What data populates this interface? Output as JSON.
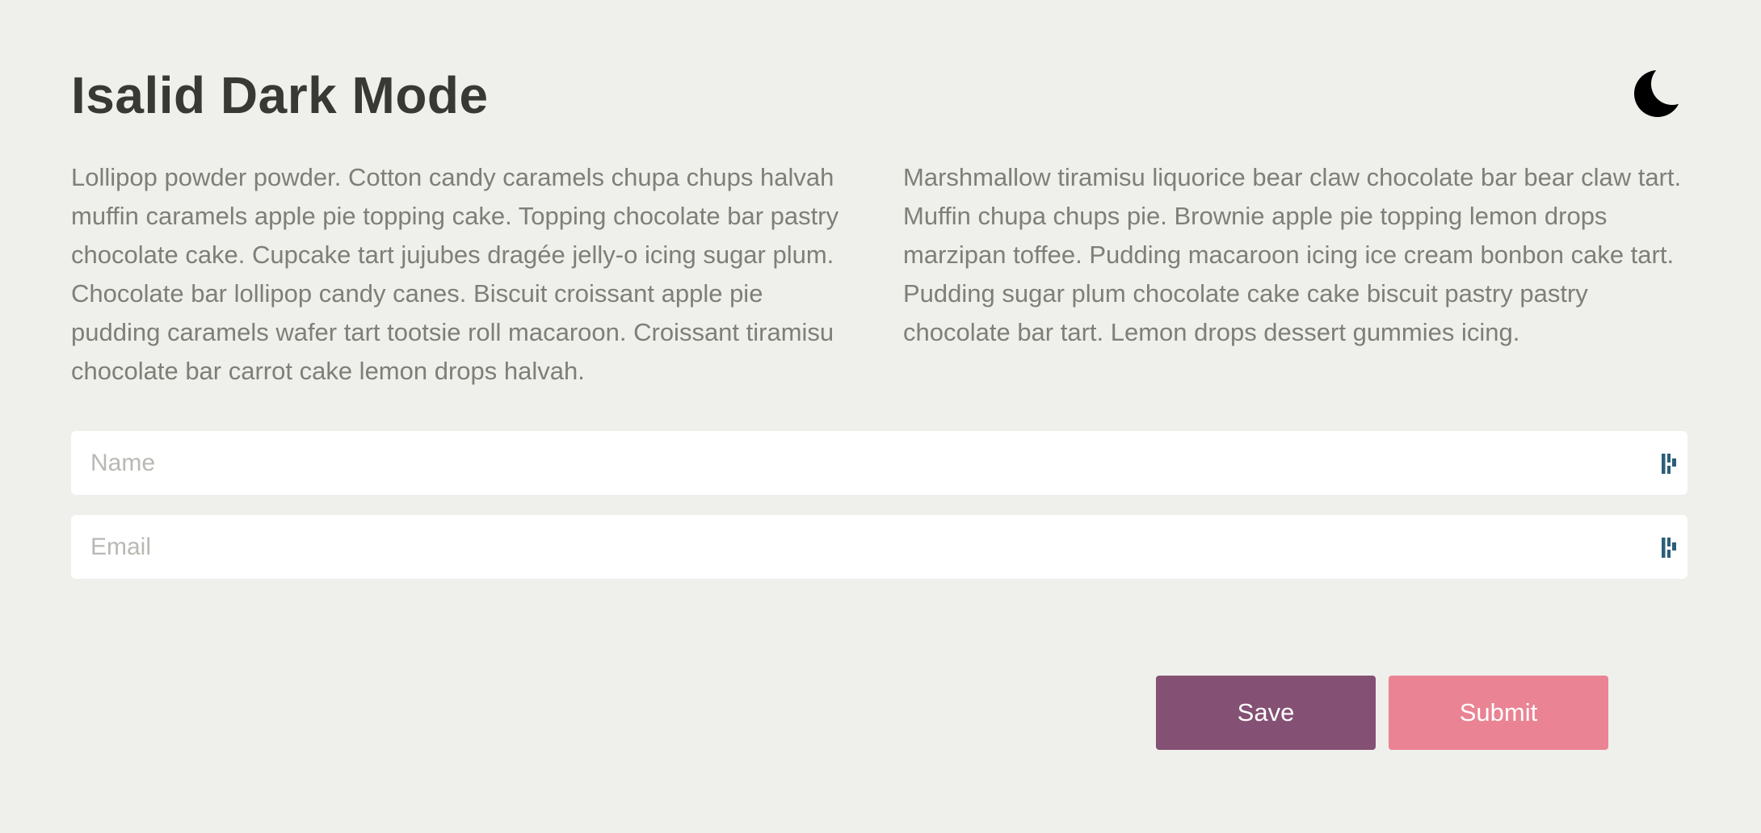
{
  "header": {
    "title": "Isalid Dark Mode",
    "toggle_icon": "moon-icon"
  },
  "content": {
    "paragraph_left": "Lollipop powder powder. Cotton candy caramels chupa chups halvah muffin caramels apple pie topping cake. Topping chocolate bar pastry chocolate cake. Cupcake tart jujubes dragée jelly-o icing sugar plum. Chocolate bar lollipop candy canes. Biscuit croissant apple pie pudding caramels wafer tart tootsie roll macaroon. Croissant tiramisu chocolate bar carrot cake lemon drops halvah.",
    "paragraph_right": "Marshmallow tiramisu liquorice bear claw chocolate bar bear claw tart. Muffin chupa chups pie. Brownie apple pie topping lemon drops marzipan toffee. Pudding macaroon icing ice cream bonbon cake tart. Pudding sugar plum chocolate cake cake biscuit pastry pastry chocolate bar tart. Lemon drops dessert gummies icing."
  },
  "form": {
    "name": {
      "placeholder": "Name",
      "value": "",
      "icon": "autofill-key-icon"
    },
    "email": {
      "placeholder": "Email",
      "value": "",
      "icon": "autofill-key-icon"
    }
  },
  "buttons": {
    "save_label": "Save",
    "submit_label": "Submit"
  },
  "colors": {
    "background": "#efefeb",
    "title_text": "#383835",
    "body_text": "#7f7f78",
    "save_button": "#845073",
    "submit_button": "#ea8393",
    "field_icon": "#2b5f77"
  }
}
